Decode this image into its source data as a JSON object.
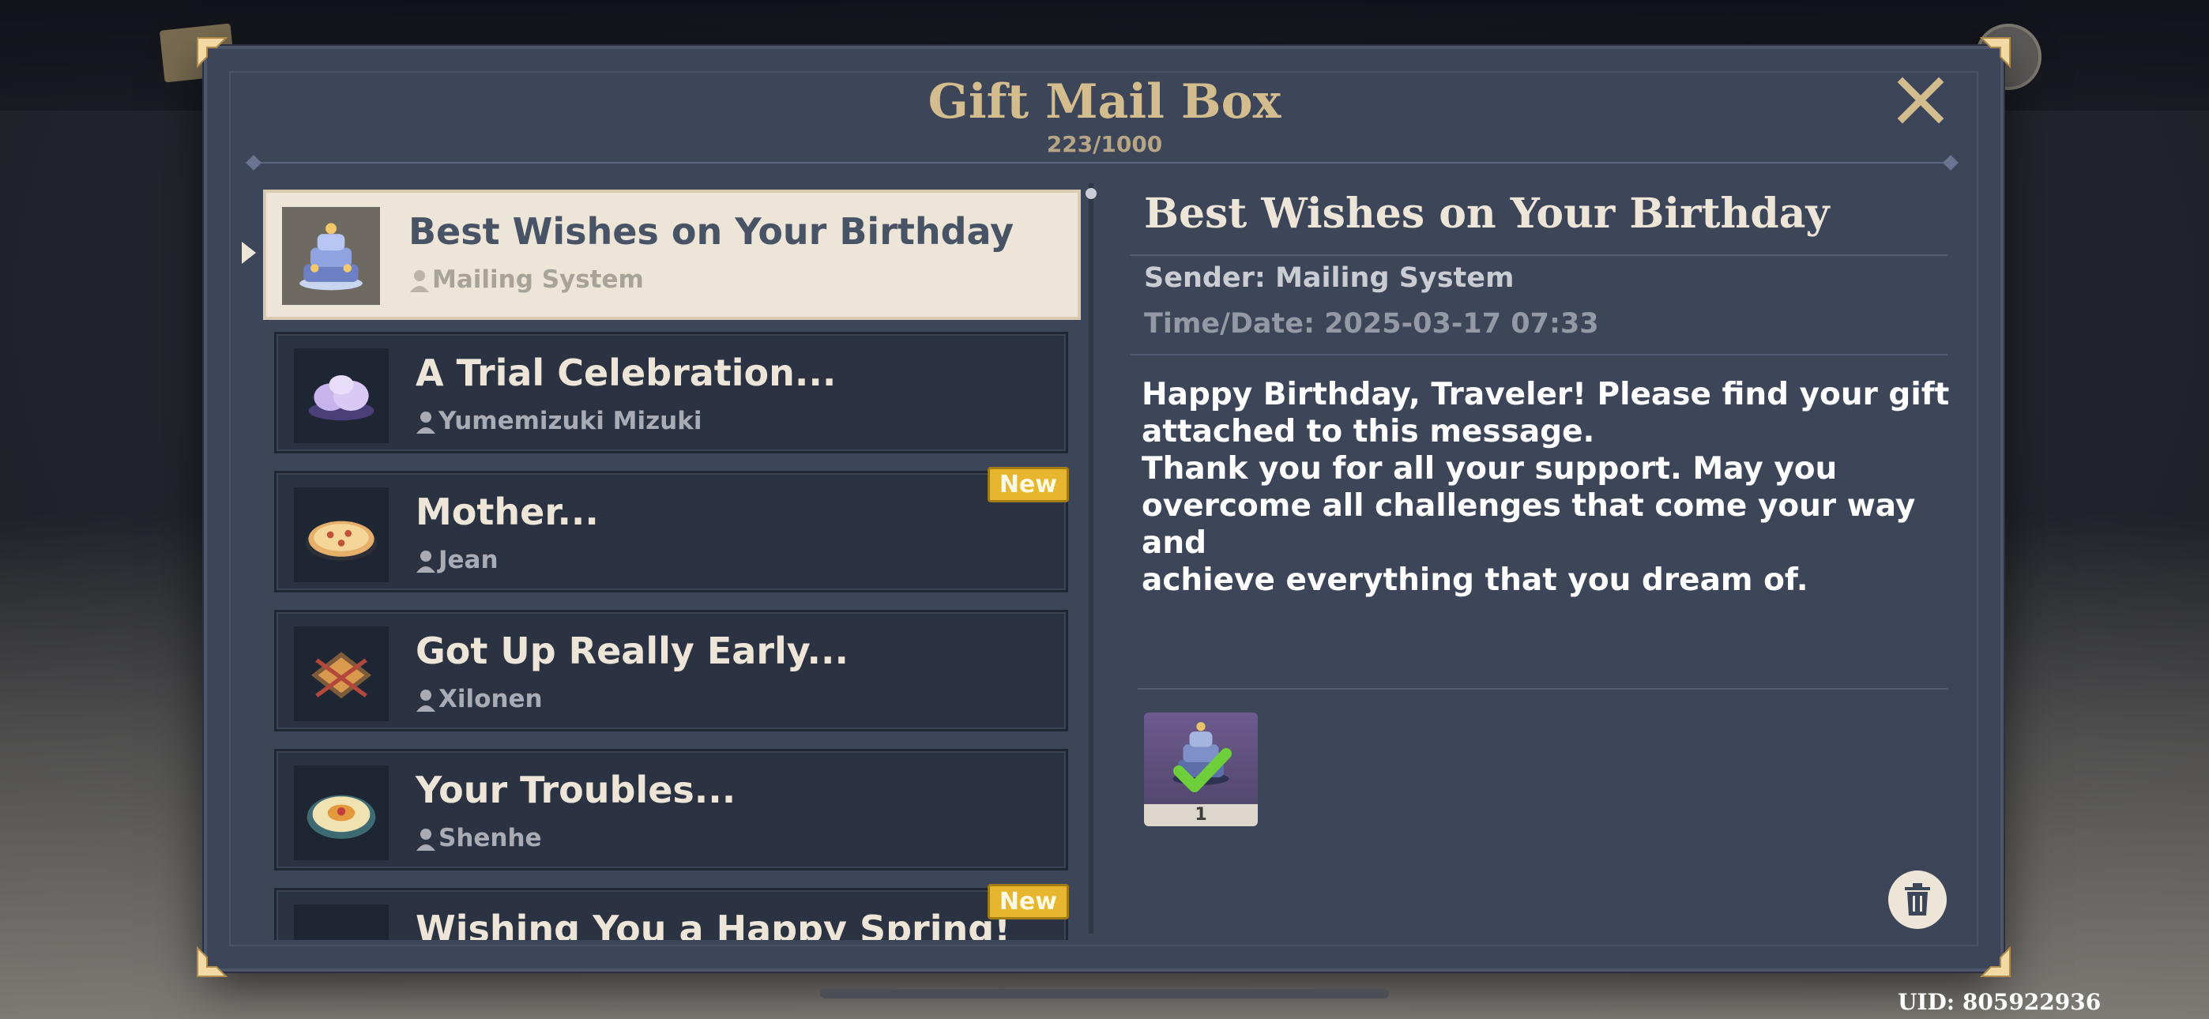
{
  "dialog": {
    "title": "Gift Mail Box",
    "count": "223/1000"
  },
  "mails": [
    {
      "subject": "Best Wishes on Your Birthday",
      "sender": "Mailing System",
      "thumb_icon": "birthday-cake-icon",
      "selected": true,
      "new": false
    },
    {
      "subject": "A Trial Celebration...",
      "sender": "Yumemizuki Mizuki",
      "thumb_icon": "purple-dessert-icon",
      "selected": false,
      "new": false
    },
    {
      "subject": "Mother...",
      "sender": "Jean",
      "thumb_icon": "pizza-dish-icon",
      "selected": false,
      "new": true,
      "badge": "New"
    },
    {
      "subject": "Got Up Really Early...",
      "sender": "Xilonen",
      "thumb_icon": "skewer-dish-icon",
      "selected": false,
      "new": false
    },
    {
      "subject": "Your Troubles...",
      "sender": "Shenhe",
      "thumb_icon": "soup-bowl-icon",
      "selected": false,
      "new": false
    },
    {
      "subject": "Wishing You a Happy Spring!",
      "sender": "",
      "thumb_icon": "food-dish-icon",
      "selected": false,
      "new": true,
      "badge": "New"
    }
  ],
  "detail": {
    "title": "Best Wishes on Your Birthday",
    "sender": "Sender: Mailing System",
    "time": "Time/Date: 2025-03-17 07:33",
    "body_lines": [
      "Happy Birthday, Traveler! Please find your gift",
      "attached to this message.",
      "Thank you for all your support. May you",
      "overcome all challenges that come your way and",
      "achieve everything that you dream of."
    ],
    "attachment": {
      "icon": "birthday-cake-icon",
      "quantity": "1",
      "claimed": true
    }
  },
  "uid": "UID: 805922936",
  "colors": {
    "panel": "#3d4558",
    "title_gold": "#d3bc8e",
    "selected_bg": "#ece5d8",
    "item_bg": "#2b3342",
    "new_badge": "#e5b62e"
  }
}
